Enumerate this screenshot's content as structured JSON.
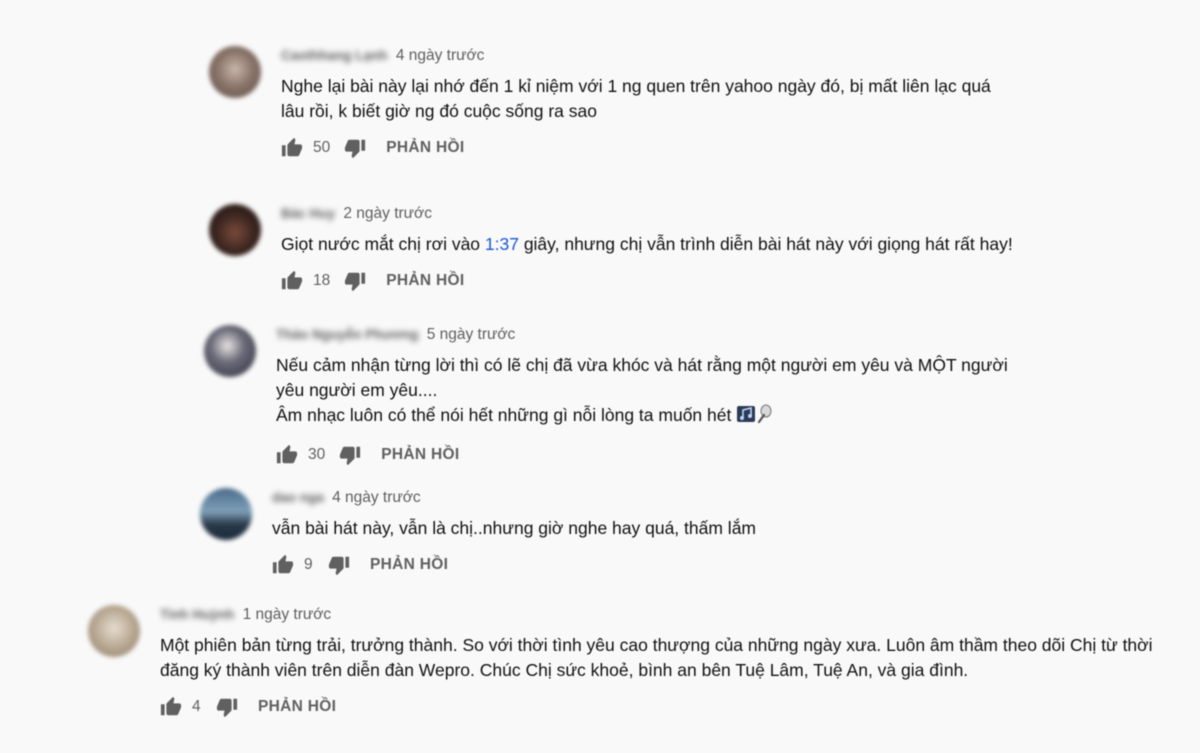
{
  "comments": [
    {
      "author": "Caothhang Lạnh",
      "time": "4 ngày trước",
      "lines": [
        "Nghe lại bài này lại nhớ đến 1 kỉ niệm với 1 ng quen trên yahoo ngày đó, bị mất liên lạc quá",
        "lâu rồi, k biết giờ ng đó cuộc sống ra sao"
      ],
      "likes": "50",
      "reply_label": "PHẢN HỒI"
    },
    {
      "author": "Bác Huy",
      "time": "2 ngày trước",
      "text_before": "Giọt nước mắt chị rơi vào ",
      "timestamp": "1:37",
      "text_after": " giây, nhưng chị vẫn trình diễn bài hát này với giọng hát rất hay!",
      "likes": "18",
      "reply_label": "PHẢN HỒI"
    },
    {
      "author": "Thảo Nguyễn Phương",
      "time": "5 ngày trước",
      "lines": [
        "Nếu cảm nhận từng lời thì có lẽ chị đã vừa khóc và hát rằng một người em yêu và MỘT người",
        "yêu người em yêu....",
        "Âm nhạc luôn có thể nói hết những gì nỗi lòng ta muốn hét"
      ],
      "emoji_names": [
        "music-notes-icon",
        "microphone-icon"
      ],
      "likes": "30",
      "reply_label": "PHẢN HỒI"
    },
    {
      "author": "dao nga",
      "time": "4 ngày trước",
      "lines": [
        "vẫn bài hát này, vẫn là chị..nhưng giờ nghe hay quá, thấm lắm"
      ],
      "likes": "9",
      "reply_label": "PHẢN HỒI"
    },
    {
      "author": "Tình Huỳnh",
      "time": "1 ngày trước",
      "lines": [
        "Một phiên bản từng trải, trưởng thành. So với thời tình yêu cao thượng của những ngày xưa. Luôn âm thầm theo dõi Chị từ thời",
        "đăng ký thành viên trên diễn đàn Wepro. Chúc Chị sức khoẻ, bình an bên Tuệ Lâm, Tuệ An, và gia đình."
      ],
      "likes": "4",
      "reply_label": "PHẢN HỒI"
    }
  ],
  "icons": {
    "like": "thumb-up-icon",
    "dislike": "thumb-down-icon"
  },
  "colors": {
    "background": "#f9f9f9",
    "secondary_text": "#606060",
    "primary_text": "#111111",
    "link": "#1a56db"
  }
}
